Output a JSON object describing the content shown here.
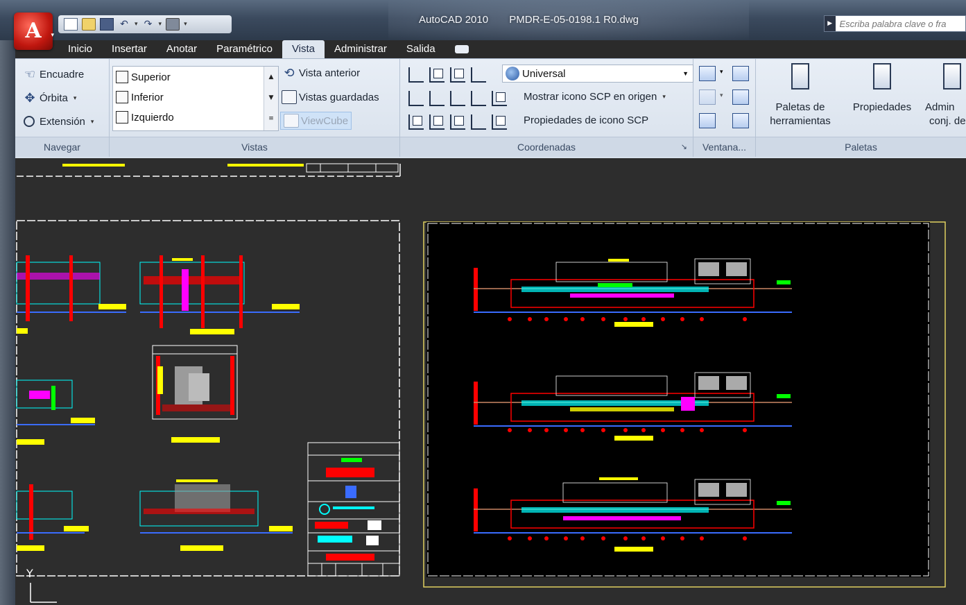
{
  "window": {
    "app_name": "AutoCAD 2010",
    "file_name": "PMDR-E-05-0198.1 R0.dwg"
  },
  "app_button": {
    "letter": "A"
  },
  "search": {
    "placeholder": "Escriba palabra clave o fra"
  },
  "tabs": [
    {
      "label": "Inicio"
    },
    {
      "label": "Insertar"
    },
    {
      "label": "Anotar"
    },
    {
      "label": "Paramétrico"
    },
    {
      "label": "Vista",
      "active": true
    },
    {
      "label": "Administrar"
    },
    {
      "label": "Salida"
    }
  ],
  "ribbon": {
    "navegar": {
      "title": "Navegar",
      "encuadre": "Encuadre",
      "orbita": "Órbita",
      "extension": "Extensión"
    },
    "vistas": {
      "title": "Vistas",
      "list": [
        "Superior",
        "Inferior",
        "Izquierdo"
      ],
      "vista_anterior": "Vista anterior",
      "vistas_guardadas": "Vistas guardadas",
      "viewcube": "ViewCube"
    },
    "coordenadas": {
      "title": "Coordenadas",
      "ucs_combo": "Universal",
      "mostrar_icono": "Mostrar icono SCP en origen",
      "propiedades_icono": "Propiedades de icono SCP"
    },
    "ventana": {
      "title": "Ventana..."
    },
    "paletas": {
      "title": "Paletas",
      "paletas_line1": "Paletas de",
      "paletas_line2": "herramientas",
      "propiedades": "Propiedades",
      "admin_line1": "Admin",
      "admin_line2": "conj. de"
    }
  },
  "colors": {
    "accent_red": "#c0170f",
    "ribbon_bg": "#dfe6ef",
    "canvas_bg": "#2d2d2d",
    "layout_paper": "#000000",
    "cad_yellow": "#ffff00",
    "cad_red": "#ff0000",
    "cad_cyan": "#00ffff",
    "cad_magenta": "#ff00ff",
    "cad_green": "#00ff00"
  },
  "canvas": {
    "ucs_y_label": "Y"
  }
}
